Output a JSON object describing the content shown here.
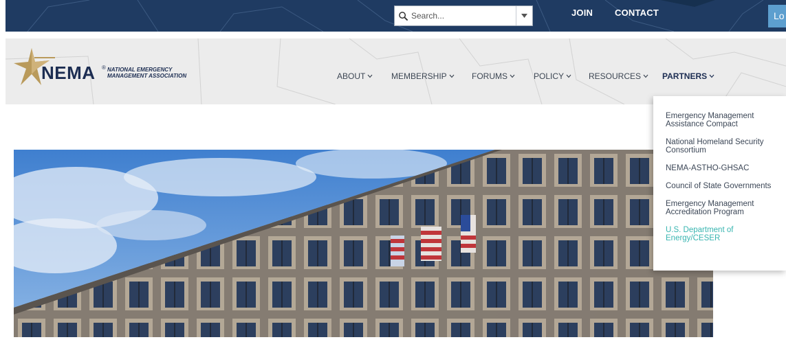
{
  "topbar": {
    "search_placeholder": "Search...",
    "join": "JOIN",
    "contact": "CONTACT",
    "login": "Lo"
  },
  "logo": {
    "name": "NEMA",
    "registered": "®",
    "subtitle_line1": "NATIONAL EMERGENCY",
    "subtitle_line2": "MANAGEMENT ASSOCIATION"
  },
  "nav": {
    "items": [
      {
        "label": "ABOUT"
      },
      {
        "label": "MEMBERSHIP"
      },
      {
        "label": "FORUMS"
      },
      {
        "label": "POLICY"
      },
      {
        "label": "RESOURCES"
      },
      {
        "label": "PARTNERS"
      }
    ]
  },
  "partners_menu": {
    "items": [
      {
        "line1": "Emergency Management",
        "line2": "Assistance Compact"
      },
      {
        "line1": "National Homeland Security",
        "line2": "Consortium"
      },
      {
        "line1": "NEMA-ASTHO-GHSAC",
        "line2": ""
      },
      {
        "line1": "Council of State Governments",
        "line2": ""
      },
      {
        "line1": "Emergency Management",
        "line2": "Accreditation Program"
      },
      {
        "line1": "U.S. Department of",
        "line2": "Energy/CESER"
      }
    ]
  },
  "colors": {
    "topbar": "#1f3b62",
    "nav_text": "#3c4653",
    "brand_navy": "#1c2d52",
    "star_gold": "#b99a5b",
    "highlight_teal": "#38b5b0",
    "login_blue": "#5d9fcf"
  },
  "icons": {
    "search": "search-icon",
    "dropdown": "chevron-down-icon",
    "logo_star": "star-icon"
  }
}
